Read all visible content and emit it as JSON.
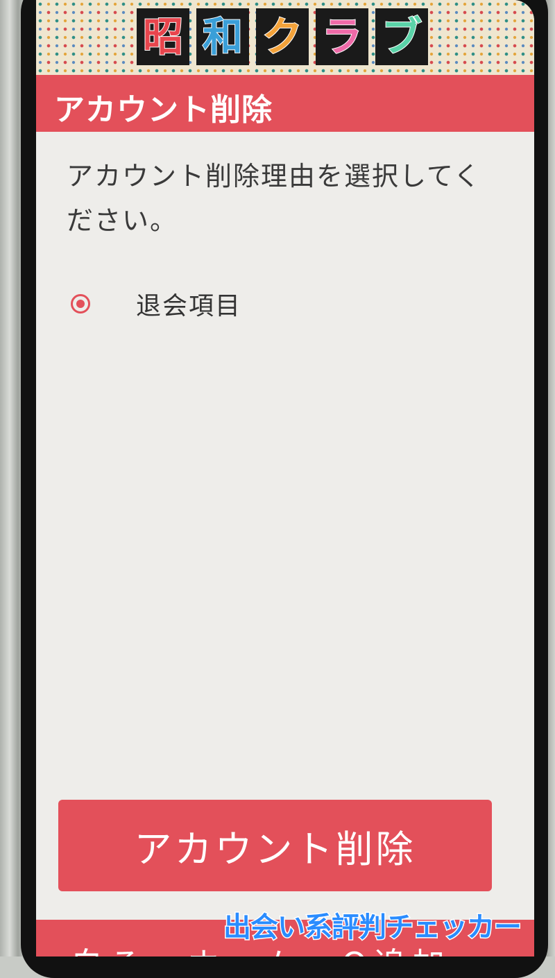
{
  "app": {
    "logo": {
      "chars": [
        {
          "char": "昭",
          "color": "#e8454d"
        },
        {
          "char": "和",
          "color": "#3a9fd8"
        },
        {
          "char": "ク",
          "color": "#f3a23a"
        },
        {
          "char": "ラ",
          "color": "#ef6aa8"
        },
        {
          "char": "ブ",
          "color": "#5ad3a8"
        }
      ]
    }
  },
  "header": {
    "title": "アカウント削除"
  },
  "main": {
    "instruction": "アカウント削除理由を選択してください。",
    "options": [
      {
        "label": "退会項目",
        "selected": true
      }
    ],
    "submit_label": "アカウント削除"
  },
  "bottom_nav": {
    "partial_text": "白ろ…ホーム…Q追加"
  },
  "watermark": {
    "text": "出会い系評判チェッカー"
  },
  "colors": {
    "accent": "#e3505a",
    "background": "#eeedea"
  }
}
